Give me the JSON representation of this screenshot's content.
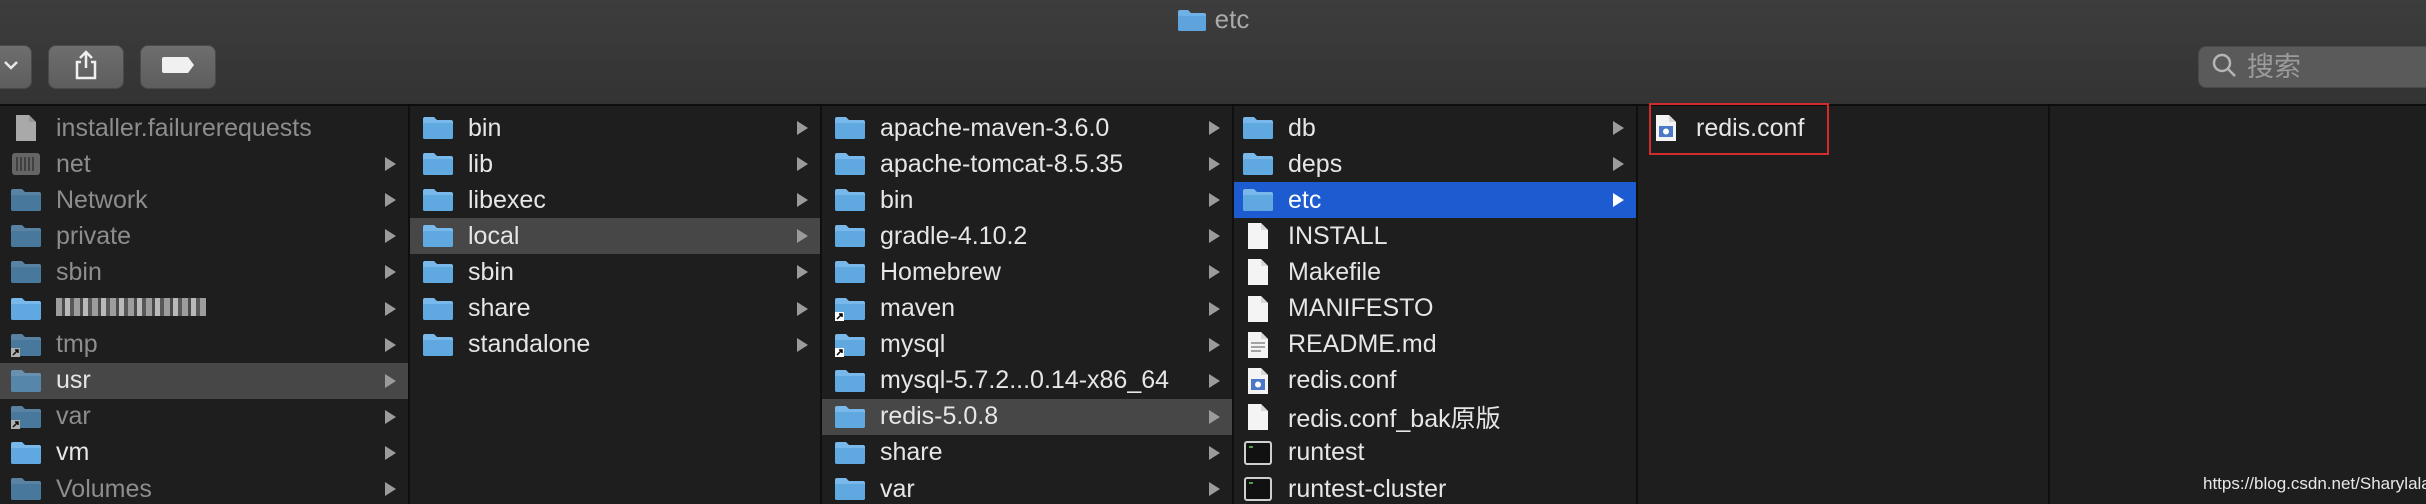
{
  "window": {
    "title": "etc"
  },
  "toolbar": {
    "search_placeholder": "搜索"
  },
  "columns": [
    {
      "items": [
        {
          "label": "installer.failurerequests",
          "icon": "document-icon",
          "arrow": false,
          "dim": true
        },
        {
          "label": "net",
          "icon": "drive-icon",
          "arrow": true,
          "dim": true
        },
        {
          "label": "Network",
          "icon": "folder-icon",
          "arrow": true,
          "dim": true
        },
        {
          "label": "private",
          "icon": "folder-icon",
          "arrow": true,
          "dim": true
        },
        {
          "label": "sbin",
          "icon": "folder-icon",
          "arrow": true,
          "dim": true
        },
        {
          "label": "",
          "icon": "folder-icon",
          "arrow": true,
          "blurred": true
        },
        {
          "label": "tmp",
          "icon": "alias-folder-icon",
          "arrow": true,
          "dim": true
        },
        {
          "label": "usr",
          "icon": "folder-icon",
          "arrow": true,
          "dim": true,
          "selected": "gray"
        },
        {
          "label": "var",
          "icon": "alias-folder-icon",
          "arrow": true,
          "dim": true
        },
        {
          "label": "vm",
          "icon": "folder-icon",
          "arrow": true
        },
        {
          "label": "Volumes",
          "icon": "folder-icon",
          "arrow": true,
          "dim": true
        }
      ]
    },
    {
      "items": [
        {
          "label": "bin",
          "icon": "folder-icon",
          "arrow": true
        },
        {
          "label": "lib",
          "icon": "folder-icon",
          "arrow": true
        },
        {
          "label": "libexec",
          "icon": "folder-icon",
          "arrow": true
        },
        {
          "label": "local",
          "icon": "folder-icon",
          "arrow": true,
          "selected": "gray"
        },
        {
          "label": "sbin",
          "icon": "folder-icon",
          "arrow": true
        },
        {
          "label": "share",
          "icon": "folder-icon",
          "arrow": true
        },
        {
          "label": "standalone",
          "icon": "folder-icon",
          "arrow": true
        }
      ]
    },
    {
      "items": [
        {
          "label": "apache-maven-3.6.0",
          "icon": "folder-icon",
          "arrow": true
        },
        {
          "label": "apache-tomcat-8.5.35",
          "icon": "folder-icon",
          "arrow": true
        },
        {
          "label": "bin",
          "icon": "folder-icon",
          "arrow": true
        },
        {
          "label": "gradle-4.10.2",
          "icon": "folder-icon",
          "arrow": true
        },
        {
          "label": "Homebrew",
          "icon": "folder-icon",
          "arrow": true
        },
        {
          "label": "maven",
          "icon": "alias-folder-icon",
          "arrow": true
        },
        {
          "label": "mysql",
          "icon": "alias-folder-icon",
          "arrow": true
        },
        {
          "label": "mysql-5.7.2...0.14-x86_64",
          "icon": "folder-icon",
          "arrow": true
        },
        {
          "label": "redis-5.0.8",
          "icon": "folder-icon",
          "arrow": true,
          "selected": "gray"
        },
        {
          "label": "share",
          "icon": "folder-icon",
          "arrow": true
        },
        {
          "label": "var",
          "icon": "folder-icon",
          "arrow": true
        }
      ]
    },
    {
      "items": [
        {
          "label": "db",
          "icon": "folder-icon",
          "arrow": true
        },
        {
          "label": "deps",
          "icon": "folder-icon",
          "arrow": true
        },
        {
          "label": "etc",
          "icon": "folder-icon",
          "arrow": true,
          "selected": "blue"
        },
        {
          "label": "INSTALL",
          "icon": "document-icon",
          "arrow": false
        },
        {
          "label": "Makefile",
          "icon": "document-icon",
          "arrow": false
        },
        {
          "label": "MANIFESTO",
          "icon": "document-icon",
          "arrow": false
        },
        {
          "label": "README.md",
          "icon": "text-file-icon",
          "arrow": false
        },
        {
          "label": "redis.conf",
          "icon": "config-file-icon",
          "arrow": false
        },
        {
          "label": "redis.conf_bak原版",
          "icon": "document-icon",
          "arrow": false
        },
        {
          "label": "runtest",
          "icon": "terminal-icon",
          "arrow": false
        },
        {
          "label": "runtest-cluster",
          "icon": "terminal-icon",
          "arrow": false
        }
      ]
    },
    {
      "items": [
        {
          "label": "redis.conf",
          "icon": "config-file-icon",
          "arrow": false
        }
      ]
    },
    {
      "items": []
    }
  ],
  "watermark": "https://blog.csdn.net/Sharylala",
  "colors": {
    "folder": "#5fa8e0",
    "selection_blue": "#1c5bd0",
    "highlight_box": "#d22b2b"
  }
}
